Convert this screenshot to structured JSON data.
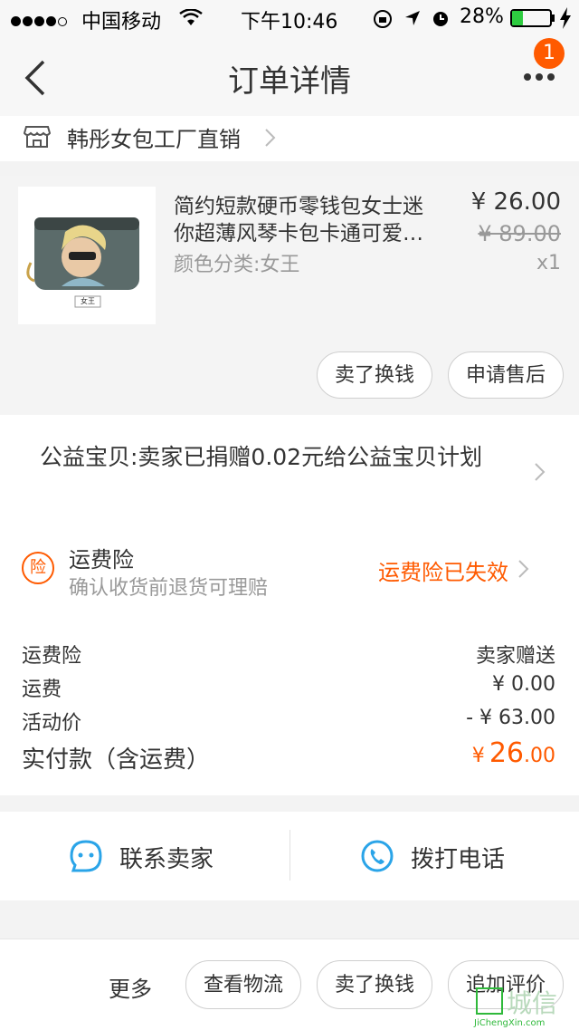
{
  "status_bar": {
    "carrier": "中国移动",
    "time": "下午10:46",
    "battery": "28%",
    "battery_level": 0.28
  },
  "nav": {
    "title": "订单详情",
    "badge_count": "1",
    "icons": [
      "back-chevron-icon",
      "more-dots-icon"
    ]
  },
  "shop": {
    "name": "韩彤女包工厂直销",
    "icon": "store-icon"
  },
  "product": {
    "title_line1": "简约短款硬币零钱包女士迷",
    "title_line2": "你超薄风琴卡包卡通可爱…",
    "sku": "颜色分类:女王",
    "price": "¥ 26.00",
    "original_price": "¥ 89.00",
    "quantity": "x1",
    "thumb_label": "女王",
    "buttons": [
      "卖了换钱",
      "申请售后"
    ]
  },
  "charity": {
    "text": "公益宝贝:卖家已捐赠0.02元给公益宝贝计划"
  },
  "insurance": {
    "icon_char": "险",
    "title": "运费险",
    "subtitle": "确认收货前退货可理赔",
    "status": "运费险已失效"
  },
  "fees": {
    "rows": [
      {
        "label": "运费险",
        "value": "卖家赠送"
      },
      {
        "label": "运费",
        "value": "¥ 0.00"
      },
      {
        "label": "活动价",
        "value": "- ¥ 63.00"
      }
    ],
    "paid_label": "实付款（含运费）",
    "paid_currency": "¥",
    "paid_int": "26",
    "paid_dec": ".00"
  },
  "contact": {
    "seller": "联系卖家",
    "call": "拨打电话"
  },
  "bottom": {
    "more": "更多",
    "buttons": [
      "查看物流",
      "卖了换钱",
      "追加评价"
    ]
  },
  "watermark": {
    "cn": "城信",
    "en": "JiChengXin.com"
  },
  "colors": {
    "accent": "#ff5a00",
    "link_blue": "#2aa4e8",
    "background": "#f3f3f3"
  }
}
